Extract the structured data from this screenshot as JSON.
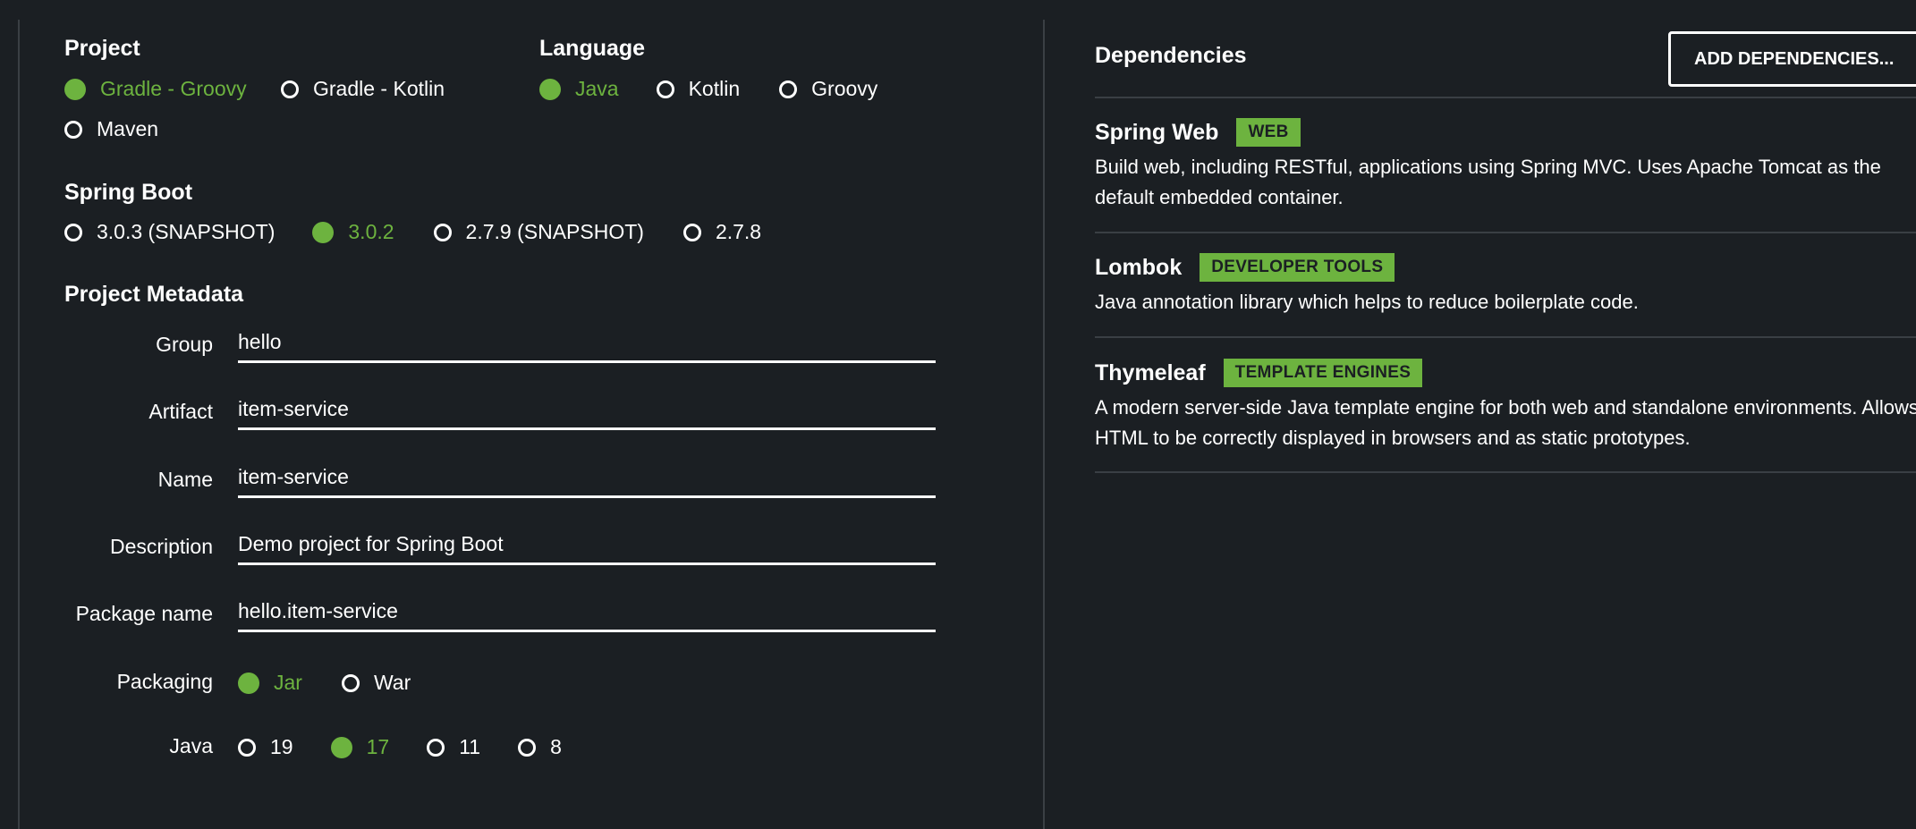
{
  "project": {
    "title": "Project",
    "options": [
      "Gradle - Groovy",
      "Gradle - Kotlin",
      "Maven"
    ],
    "selected": "Gradle - Groovy"
  },
  "language": {
    "title": "Language",
    "options": [
      "Java",
      "Kotlin",
      "Groovy"
    ],
    "selected": "Java"
  },
  "spring_boot": {
    "title": "Spring Boot",
    "options": [
      "3.0.3 (SNAPSHOT)",
      "3.0.2",
      "2.7.9 (SNAPSHOT)",
      "2.7.8"
    ],
    "selected": "3.0.2"
  },
  "metadata": {
    "title": "Project Metadata",
    "fields": {
      "group": {
        "label": "Group",
        "value": "hello"
      },
      "artifact": {
        "label": "Artifact",
        "value": "item-service"
      },
      "name": {
        "label": "Name",
        "value": "item-service"
      },
      "description": {
        "label": "Description",
        "value": "Demo project for Spring Boot"
      },
      "package_name": {
        "label": "Package name",
        "value": "hello.item-service"
      }
    },
    "packaging": {
      "label": "Packaging",
      "options": [
        "Jar",
        "War"
      ],
      "selected": "Jar"
    },
    "java": {
      "label": "Java",
      "options": [
        "19",
        "17",
        "11",
        "8"
      ],
      "selected": "17"
    }
  },
  "dependencies": {
    "title": "Dependencies",
    "add_button": "ADD DEPENDENCIES...",
    "items": [
      {
        "name": "Spring Web",
        "badge": "WEB",
        "desc_line1": "Build web, including RESTful, applications using Spring MVC. Uses Apache Tomcat as the",
        "desc_line2": "default embedded container."
      },
      {
        "name": "Lombok",
        "badge": "DEVELOPER TOOLS",
        "desc_line1": "Java annotation library which helps to reduce boilerplate code."
      },
      {
        "name": "Thymeleaf",
        "badge": "TEMPLATE ENGINES",
        "desc_line1": "A modern server-side Java template engine for both web and standalone environments. Allows",
        "desc_line2": "HTML to be correctly displayed in browsers and as static prototypes."
      }
    ]
  },
  "colors": {
    "background": "#1b1f23",
    "accent": "#6db33f",
    "divider": "#3a3f44"
  }
}
